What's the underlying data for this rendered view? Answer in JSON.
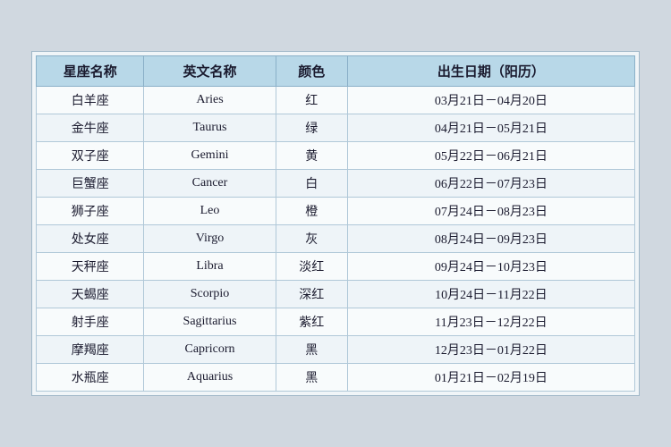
{
  "table": {
    "headers": {
      "col1": "星座名称",
      "col2": "英文名称",
      "col3": "颜色",
      "col4": "出生日期（阳历）"
    },
    "rows": [
      {
        "zh": "白羊座",
        "en": "Aries",
        "color": "红",
        "date": "03月21日－04月20日"
      },
      {
        "zh": "金牛座",
        "en": "Taurus",
        "color": "绿",
        "date": "04月21日－05月21日"
      },
      {
        "zh": "双子座",
        "en": "Gemini",
        "color": "黄",
        "date": "05月22日－06月21日"
      },
      {
        "zh": "巨蟹座",
        "en": "Cancer",
        "color": "白",
        "date": "06月22日－07月23日"
      },
      {
        "zh": "狮子座",
        "en": "Leo",
        "color": "橙",
        "date": "07月24日－08月23日"
      },
      {
        "zh": "处女座",
        "en": "Virgo",
        "color": "灰",
        "date": "08月24日－09月23日"
      },
      {
        "zh": "天秤座",
        "en": "Libra",
        "color": "淡红",
        "date": "09月24日－10月23日"
      },
      {
        "zh": "天蝎座",
        "en": "Scorpio",
        "color": "深红",
        "date": "10月24日－11月22日"
      },
      {
        "zh": "射手座",
        "en": "Sagittarius",
        "color": "紫红",
        "date": "11月23日－12月22日"
      },
      {
        "zh": "摩羯座",
        "en": "Capricorn",
        "color": "黑",
        "date": "12月23日－01月22日"
      },
      {
        "zh": "水瓶座",
        "en": "Aquarius",
        "color": "黑",
        "date": "01月21日－02月19日"
      }
    ]
  }
}
